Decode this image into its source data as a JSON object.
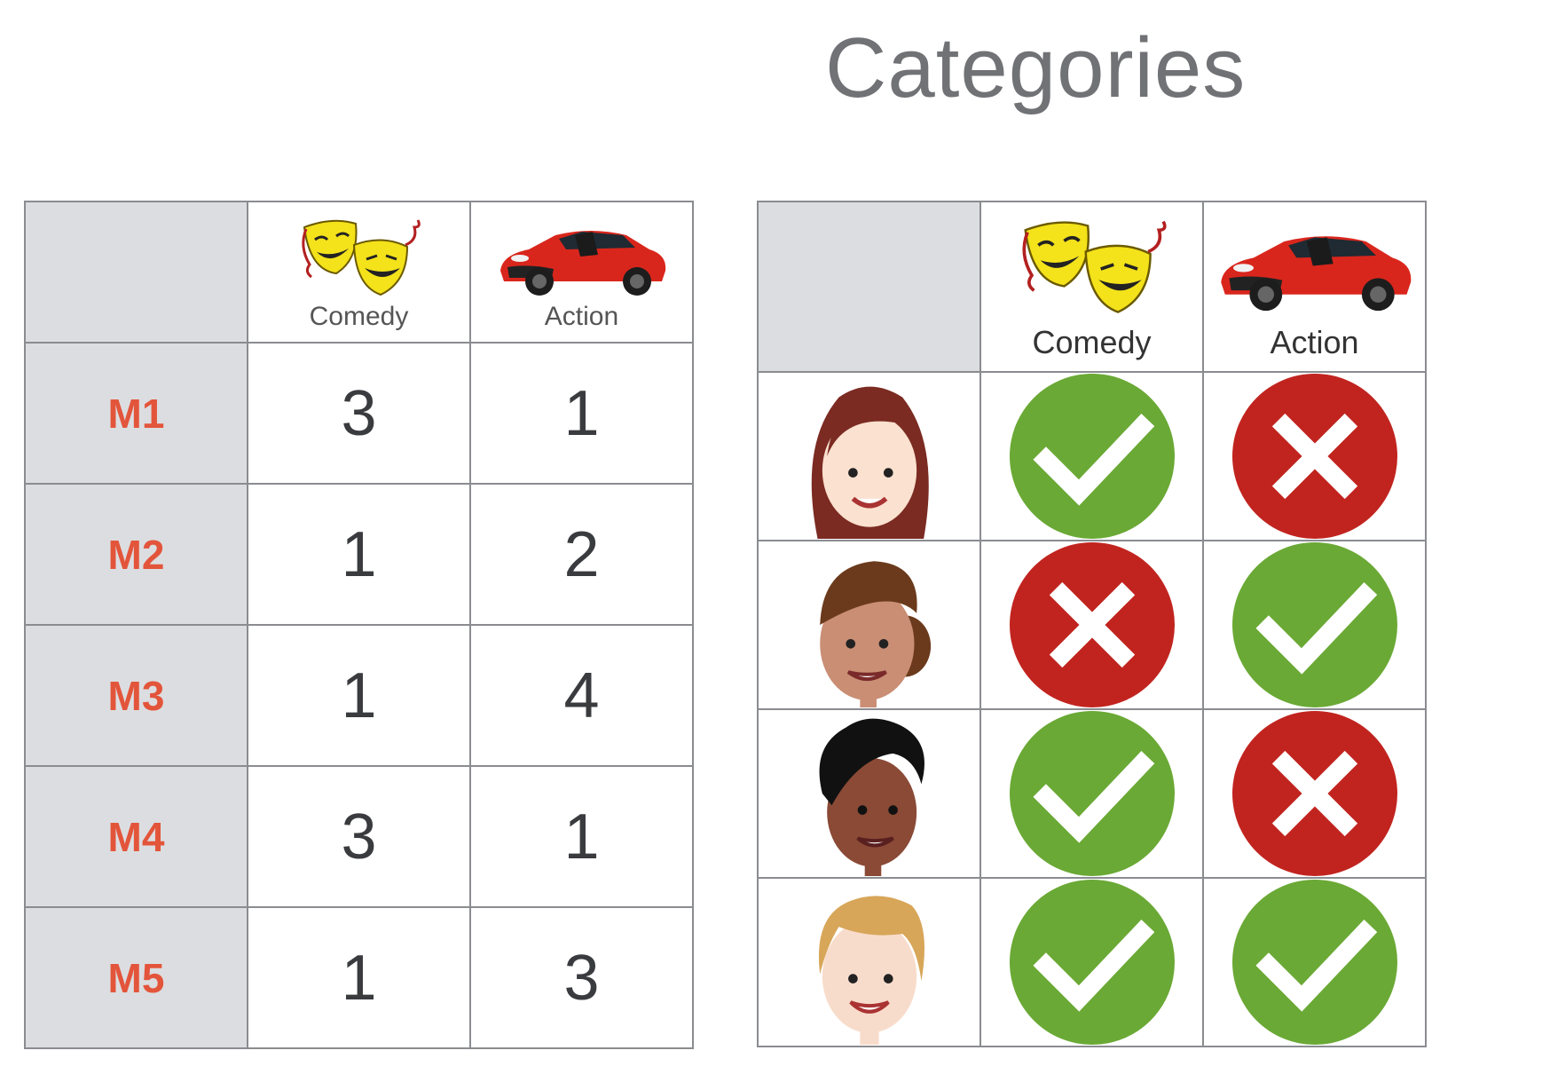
{
  "title": "Categories",
  "columns": [
    {
      "label": "Comedy",
      "icon": "comedy-masks-icon"
    },
    {
      "label": "Action",
      "icon": "red-car-icon"
    }
  ],
  "movie_table": {
    "rows": [
      {
        "label": "M1",
        "comedy": "3",
        "action": "1"
      },
      {
        "label": "M2",
        "comedy": "1",
        "action": "2"
      },
      {
        "label": "M3",
        "comedy": "1",
        "action": "4"
      },
      {
        "label": "M4",
        "comedy": "3",
        "action": "1"
      },
      {
        "label": "M5",
        "comedy": "1",
        "action": "3"
      }
    ]
  },
  "user_table": {
    "rows": [
      {
        "avatar": "woman-long-brown-hair-avatar",
        "comedy": "check-icon",
        "action": "cross-icon"
      },
      {
        "avatar": "woman-bun-hair-avatar",
        "comedy": "cross-icon",
        "action": "check-icon"
      },
      {
        "avatar": "man-curly-black-hair-avatar",
        "comedy": "check-icon",
        "action": "cross-icon"
      },
      {
        "avatar": "boy-blond-hair-avatar",
        "comedy": "check-icon",
        "action": "check-icon"
      }
    ]
  },
  "colors": {
    "check": "#6aa935",
    "cross": "#c1241f",
    "row_label": "#e3553b",
    "header_bg": "#dcdde0",
    "grid": "#8a8c90"
  }
}
